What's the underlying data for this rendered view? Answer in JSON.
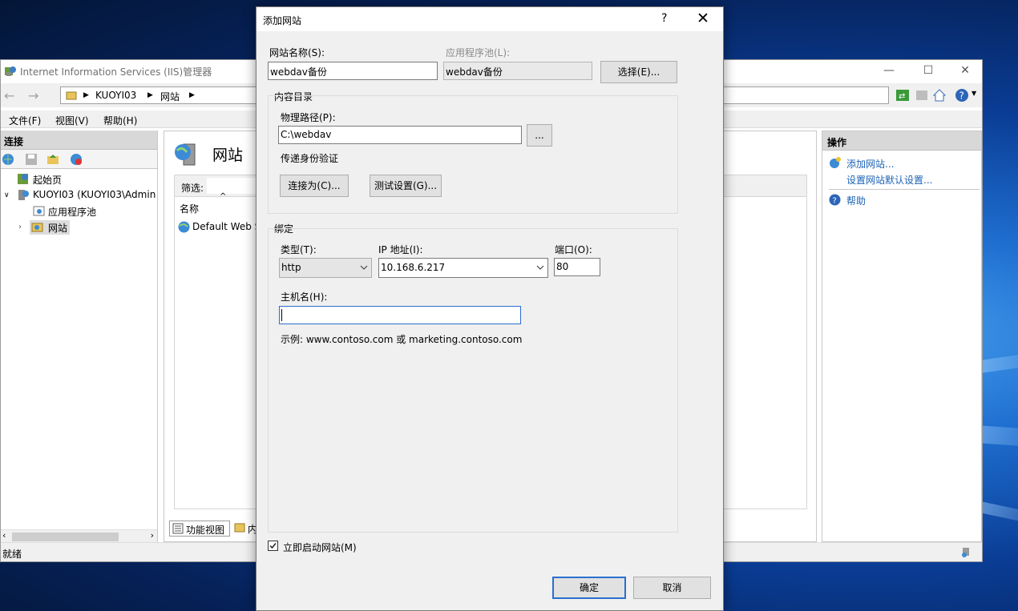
{
  "iis": {
    "title": "Internet Information Services (IIS)管理器",
    "breadcrumbs": [
      "KUOYI03",
      "网站"
    ],
    "menu": [
      "文件(F)",
      "视图(V)",
      "帮助(H)"
    ],
    "connections_header": "连接",
    "tree": {
      "start_page": "起始页",
      "server": "KUOYI03 (KUOYI03\\Admin",
      "app_pools": "应用程序池",
      "sites": "网站"
    },
    "center": {
      "title": "网站",
      "filter_label": "筛选:",
      "column_name": "名称",
      "row_default_site": "Default Web S",
      "tab_features": "功能视图",
      "tab_content": "内"
    },
    "actions": {
      "header": "操作",
      "add_site": "添加网站...",
      "set_defaults": "设置网站默认设置...",
      "help": "帮助"
    },
    "status": "就绪"
  },
  "dialog": {
    "title": "添加网站",
    "help_glyph": "?",
    "close_glyph": "✕",
    "site_name_label": "网站名称(S):",
    "site_name_value": "webdav备份",
    "app_pool_label": "应用程序池(L):",
    "app_pool_value": "webdav备份",
    "select_button": "选择(E)...",
    "content_dir_group": "内容目录",
    "physical_path_label": "物理路径(P):",
    "physical_path_value": "C:\\webdav",
    "browse_button": "...",
    "pass_auth_label": "传递身份验证",
    "connect_as_button": "连接为(C)...",
    "test_settings_button": "测试设置(G)...",
    "binding_group": "绑定",
    "type_label": "类型(T):",
    "type_value": "http",
    "ip_label": "IP 地址(I):",
    "ip_value": "10.168.6.217",
    "port_label": "端口(O):",
    "port_value": "80",
    "hostname_label": "主机名(H):",
    "hostname_value": "",
    "example_text": "示例: www.contoso.com 或 marketing.contoso.com",
    "autostart_label": "立即启动网站(M)",
    "autostart_checked": true,
    "ok_button": "确定",
    "cancel_button": "取消"
  },
  "colors": {
    "accent": "#2a6fcf",
    "link": "#1b62b3",
    "desktop": "#0a3d96"
  }
}
